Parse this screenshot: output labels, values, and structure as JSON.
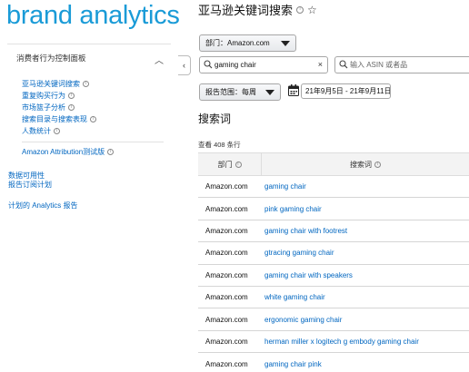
{
  "sidebar": {
    "brand": "brand analytics",
    "section_title": "消费者行为控制面板",
    "items": [
      {
        "label": "亚马逊关键词搜索"
      },
      {
        "label": "重复购买行为"
      },
      {
        "label": "市场篮子分析"
      },
      {
        "label": "搜索目录与搜索表现"
      },
      {
        "label": "人数统计"
      }
    ],
    "attribution": "Amazon Attribution测试版",
    "links": [
      "数据可用性",
      "报告订阅计划",
      "计划的 Analytics 报告"
    ]
  },
  "header": {
    "title": "亚马逊关键词搜索"
  },
  "filters": {
    "department_label": "部门：Amazon.com",
    "search_value": "gaming chair",
    "asin_placeholder": "输入 ASIN 或者品",
    "report_range_label": "报告范围：每周",
    "date_range": "21年9月5日 - 21年9月11日"
  },
  "results": {
    "section_title": "搜索词",
    "count_text": "查看 408 条行",
    "columns": [
      "部门",
      "搜索词"
    ],
    "rows": [
      {
        "department": "Amazon.com",
        "term": "gaming chair"
      },
      {
        "department": "Amazon.com",
        "term": "pink gaming chair"
      },
      {
        "department": "Amazon.com",
        "term": "gaming chair with footrest"
      },
      {
        "department": "Amazon.com",
        "term": "gtracing gaming chair"
      },
      {
        "department": "Amazon.com",
        "term": "gaming chair with speakers"
      },
      {
        "department": "Amazon.com",
        "term": "white gaming chair"
      },
      {
        "department": "Amazon.com",
        "term": "ergonomic gaming chair"
      },
      {
        "department": "Amazon.com",
        "term": "herman miller x logitech g embody gaming chair"
      },
      {
        "department": "Amazon.com",
        "term": "gaming chair pink"
      }
    ]
  },
  "colors": {
    "brand": "#1a9bd7",
    "link": "#0066c0"
  },
  "icons": [
    "info-icon",
    "star-icon",
    "search-icon",
    "clear-icon",
    "calendar-icon",
    "chevron-up-icon",
    "chevron-left-icon",
    "dropdown-arrow-icon"
  ]
}
